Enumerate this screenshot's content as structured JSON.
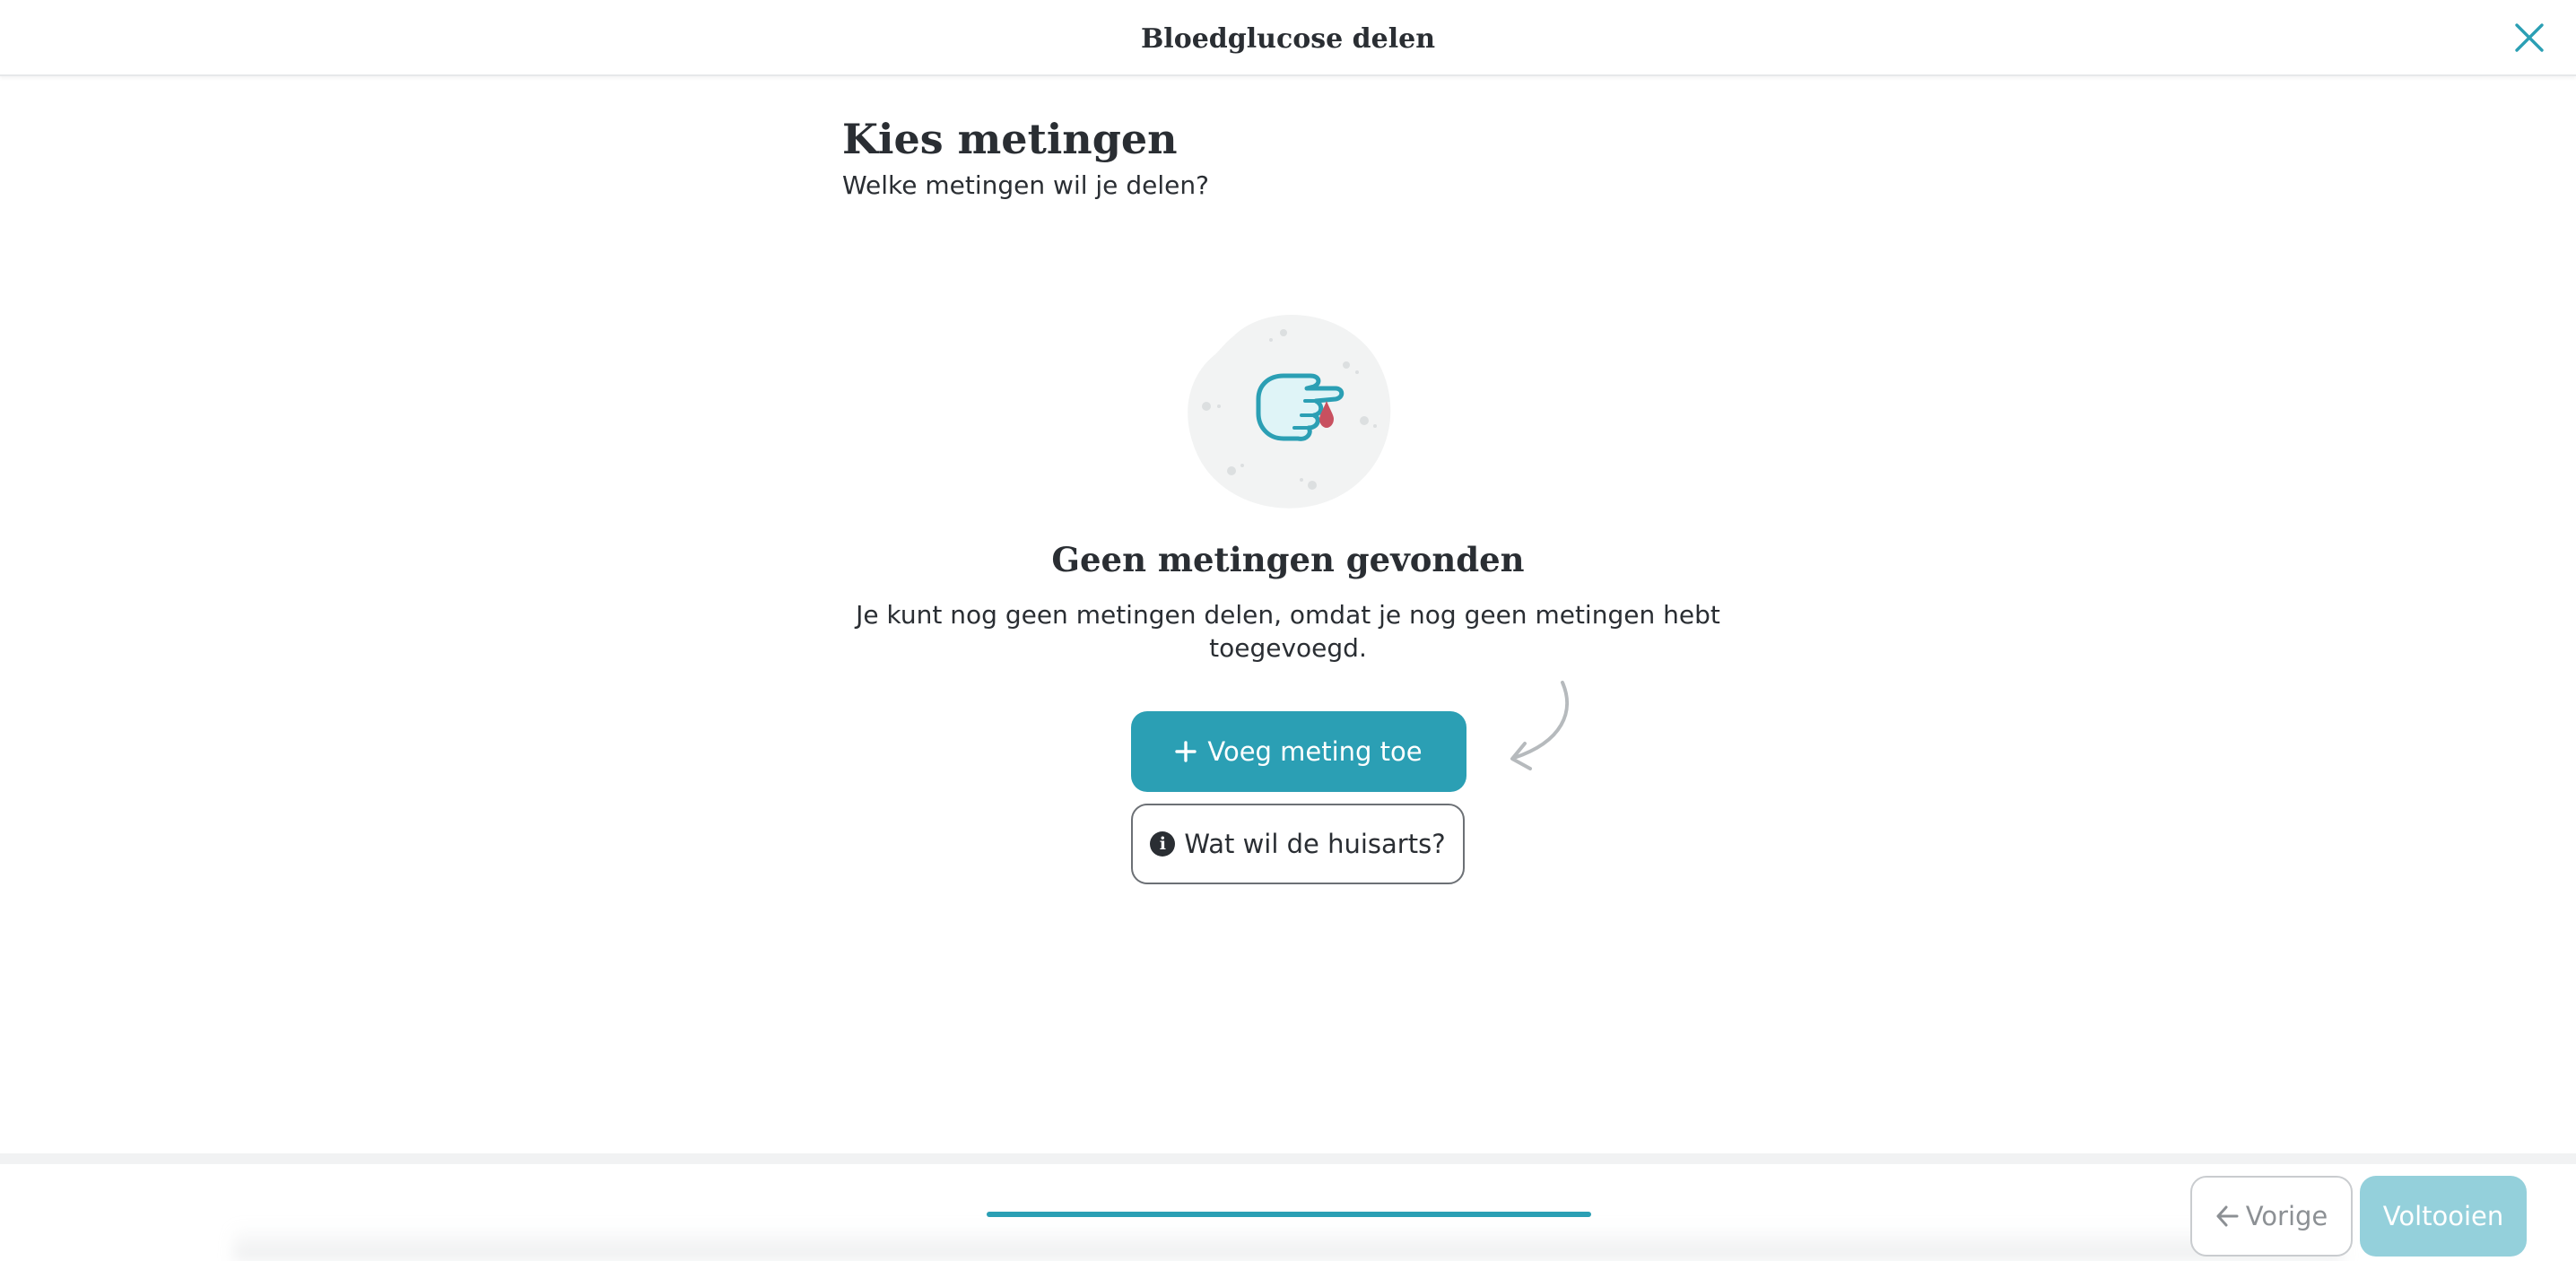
{
  "header": {
    "title": "Bloedglucose delen",
    "close_icon": "close-icon"
  },
  "main": {
    "title": "Kies metingen",
    "subtitle": "Welke metingen wil je delen?",
    "empty_state": {
      "illustration": "finger-prick-icon",
      "title": "Geen metingen gevonden",
      "text": "Je kunt nog geen metingen delen, omdat je nog geen metingen hebt toegevoegd.",
      "add_button": {
        "icon": "plus-icon",
        "label": "Voeg meting toe"
      },
      "info_button": {
        "icon": "info-icon",
        "icon_glyph": "i",
        "label": "Wat wil de huisarts?"
      }
    }
  },
  "footer": {
    "progress": 1.0,
    "prev_button": {
      "icon": "arrow-left-icon",
      "label": "Vorige"
    },
    "finish_button": {
      "label": "Voltooien"
    }
  },
  "colors": {
    "primary": "#2b9fb4",
    "primary_disabled": "#94d0db",
    "text": "#2a2e33"
  }
}
